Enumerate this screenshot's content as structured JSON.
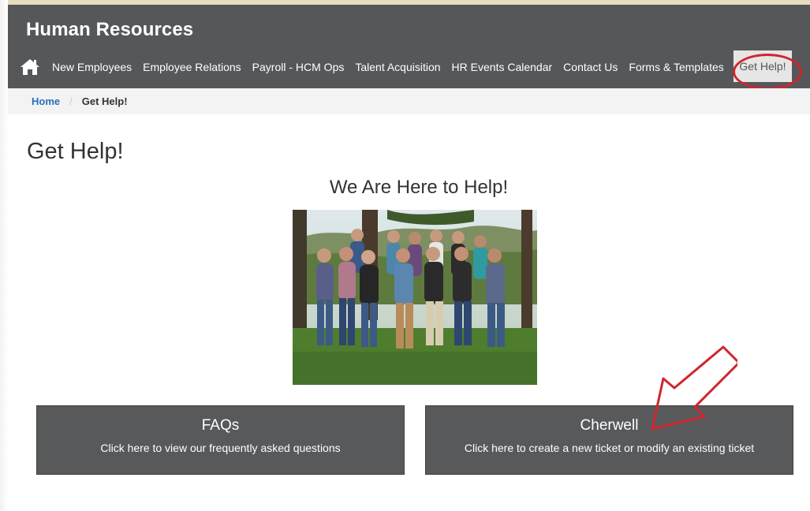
{
  "header": {
    "title": "Human Resources",
    "nav": [
      "New Employees",
      "Employee Relations",
      "Payroll - HCM Ops",
      "Talent Acquisition",
      "HR Events Calendar",
      "Contact Us",
      "Forms & Templates"
    ],
    "active_item": "Get Help!",
    "home_icon": "home-icon"
  },
  "breadcrumb": {
    "home": "Home",
    "separator": "/",
    "current": "Get Help!"
  },
  "main": {
    "page_title": "Get Help!",
    "section_title": "We Are Here to Help!"
  },
  "cards": [
    {
      "title": "FAQs",
      "description": "Click here to view our frequently asked questions"
    },
    {
      "title": "Cherwell",
      "description": "Click here to create a new ticket or modify an existing ticket"
    }
  ],
  "colors": {
    "header_bg": "#555759",
    "card_bg": "#58595b",
    "link": "#2a6ebb",
    "annotation": "#d0262d"
  }
}
